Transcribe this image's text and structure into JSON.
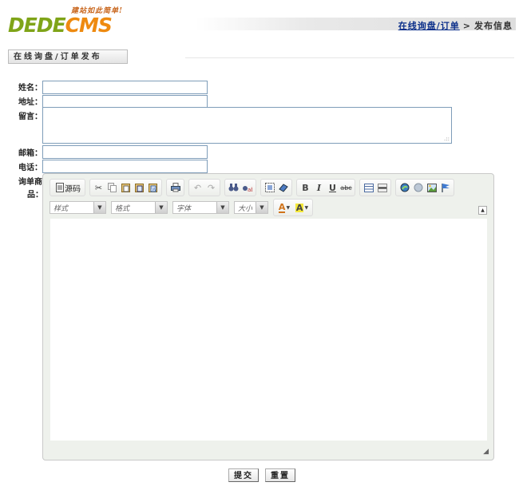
{
  "logo": {
    "slogan": "建站如此简单!",
    "word_dede": "DEDE",
    "word_cms": "CMS"
  },
  "breadcrumb": {
    "link": "在线询盘/订单",
    "separator": ">",
    "current": "发布信息"
  },
  "tab": {
    "label": "在线询盘/订单发布"
  },
  "form": {
    "name_label": "姓名：",
    "address_label": "地址：",
    "message_label": "留言：",
    "email_label": "邮箱：",
    "phone_label": "电话：",
    "product_label_1": "询单商",
    "product_label_2": "品：",
    "name_value": "",
    "address_value": "",
    "message_value": "",
    "email_value": "",
    "phone_value": ""
  },
  "editor": {
    "source_label": "源码",
    "bold": "B",
    "italic": "I",
    "underline": "U",
    "strike": "abc",
    "combos": [
      "样式",
      "格式",
      "字体",
      "大小"
    ],
    "text_color": "A",
    "bg_color": "A"
  },
  "buttons": {
    "submit": "提交",
    "reset": "重置"
  },
  "colors": {
    "dede": "#7fa418",
    "cms": "#ee8a10",
    "link": "#0b2f8a",
    "field_border": "#7f9db9"
  }
}
